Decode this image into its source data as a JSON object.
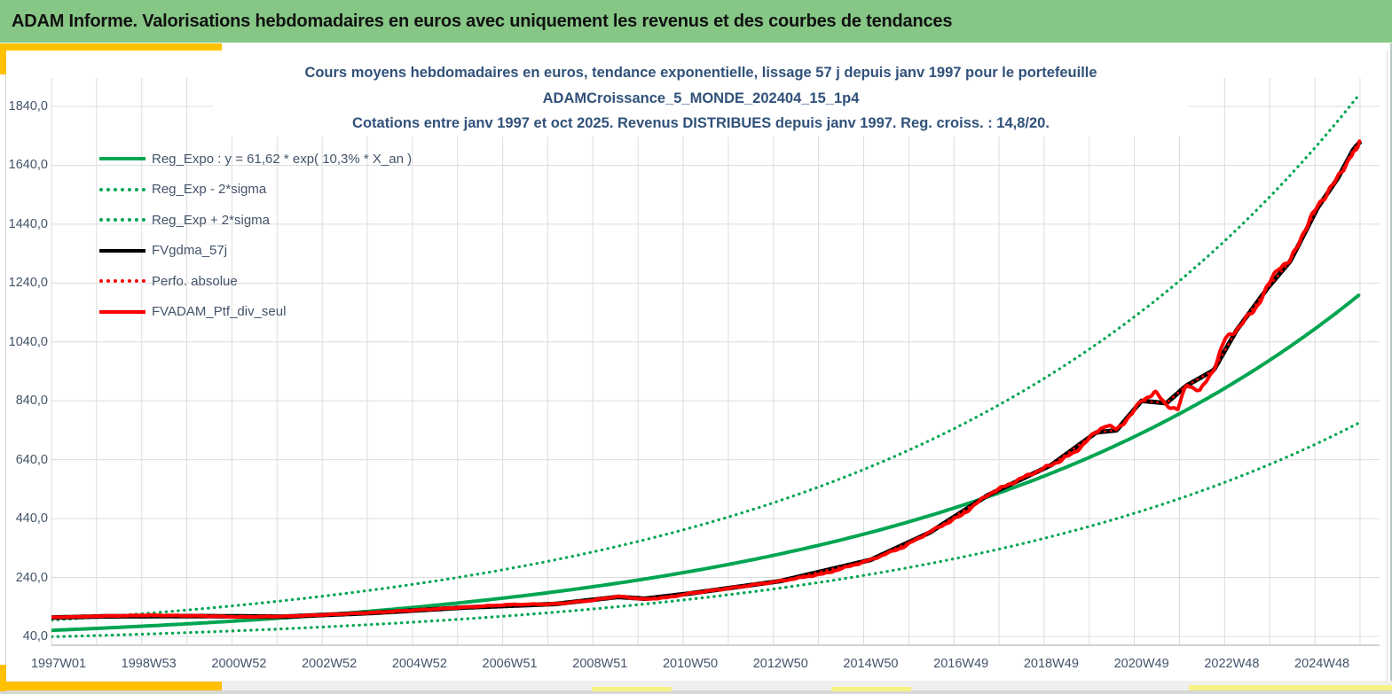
{
  "header": {
    "title": "ADAM Informe. Valorisations hebdomadaires en euros avec uniquement les revenus et des courbes de tendances",
    "bg_color": "#86c786"
  },
  "chart": {
    "title_line1": "Cours moyens hebdomadaires  en euros, tendance exponentielle, lissage 57 j depuis janv 1997 pour le portefeuille",
    "title_line2": "ADAMCroissance_5_MONDE_202404_15_1p4",
    "title_line3": "Cotations  entre janv 1997 et oct 2025. Revenus DISTRIBUES depuis janv 1997. Reg. croiss. : 14,8/20."
  },
  "legend": {
    "items": [
      {
        "label": "Reg_Expo : y = 61,62 * exp( 10,3% *  X_an )",
        "color": "#00a551",
        "style": "solid"
      },
      {
        "label": "Reg_Exp - 2*sigma",
        "color": "#00a551",
        "style": "dotted"
      },
      {
        "label": "Reg_Exp + 2*sigma",
        "color": "#00a551",
        "style": "dotted"
      },
      {
        "label": "FVgdma_57j",
        "color": "#000000",
        "style": "solid"
      },
      {
        "label": "Perfo. absolue",
        "color": "#ff0000",
        "style": "dotted"
      },
      {
        "label": "FVADAM_Ptf_div_seul",
        "color": "#ff0000",
        "style": "solid"
      }
    ]
  },
  "accents": {
    "gold": "#ffc000",
    "pale_yellow": "#f4f283"
  },
  "chart_data": {
    "type": "line",
    "x_axis": {
      "unit": "week (ISO year-week)",
      "tick_labels": [
        "1997W01",
        "1998W53",
        "2000W52",
        "2002W52",
        "2004W52",
        "2006W51",
        "2008W51",
        "2010W50",
        "2012W50",
        "2014W50",
        "2016W49",
        "2018W49",
        "2020W49",
        "2022W48",
        "2024W48"
      ],
      "years_span": [
        0,
        28.85
      ],
      "gridline_every_years": 1
    },
    "y_axis": {
      "tick_labels": [
        "40,0",
        "240,0",
        "440,0",
        "640,0",
        "840,0",
        "1040,0",
        "1240,0",
        "1440,0",
        "1640,0",
        "1840,0"
      ],
      "tick_values": [
        40,
        240,
        440,
        640,
        840,
        1040,
        1240,
        1440,
        1640,
        1840
      ],
      "ylim": [
        40,
        1840
      ],
      "grid": true,
      "grid_color": "#dcdcdc"
    },
    "regression": {
      "a": 61.62,
      "rate": 0.103,
      "sigma2_upper_factor": 1.567,
      "sigma2_lower_factor": 0.638,
      "equation": "y = 61,62 * exp( 10,3% * X_an )",
      "score": "14,8/20"
    },
    "series": [
      {
        "name": "Reg_Expo",
        "kind": "expo",
        "factor": 1.0,
        "color": "#00a551",
        "dash": "solid",
        "width": 4
      },
      {
        "name": "Reg_Exp - 2*sigma",
        "kind": "expo",
        "factor": 0.638,
        "color": "#00a551",
        "dash": "dotted",
        "width": 3.2
      },
      {
        "name": "Reg_Exp + 2*sigma",
        "kind": "expo",
        "factor": 1.567,
        "color": "#00a551",
        "dash": "dotted",
        "width": 3.2
      },
      {
        "name": "FVgdma_57j",
        "kind": "points",
        "color": "#000000",
        "dash": "solid",
        "width": 5.2,
        "wiggle": false,
        "points": [
          [
            -0.15,
            104
          ],
          [
            1,
            108
          ],
          [
            3,
            109
          ],
          [
            5,
            107
          ],
          [
            7,
            120
          ],
          [
            9,
            138
          ],
          [
            11,
            150
          ],
          [
            12.4,
            174
          ],
          [
            13,
            168
          ],
          [
            14,
            186
          ],
          [
            16,
            228
          ],
          [
            18,
            300
          ],
          [
            19.3,
            392
          ],
          [
            20.6,
            520
          ],
          [
            22,
            622
          ],
          [
            23,
            733
          ],
          [
            23.45,
            740
          ],
          [
            24,
            840
          ],
          [
            24.55,
            832
          ],
          [
            25,
            892
          ],
          [
            25.6,
            944
          ],
          [
            26.1,
            1078
          ],
          [
            26.8,
            1224
          ],
          [
            27.3,
            1315
          ],
          [
            27.9,
            1495
          ],
          [
            28.35,
            1596
          ],
          [
            28.7,
            1695
          ],
          [
            28.85,
            1720
          ]
        ]
      },
      {
        "name": "Perfo. absolue",
        "kind": "points",
        "color": "#ff0000",
        "dash": "dotted",
        "width": 2.6,
        "wiggle": false,
        "points": [
          [
            -0.15,
            104
          ],
          [
            1,
            108
          ],
          [
            3,
            109
          ],
          [
            5,
            107
          ],
          [
            7,
            120
          ],
          [
            9,
            138
          ],
          [
            11,
            150
          ],
          [
            12.4,
            174
          ],
          [
            13,
            168
          ],
          [
            14,
            186
          ],
          [
            16,
            228
          ],
          [
            18,
            300
          ],
          [
            19.3,
            392
          ],
          [
            20.6,
            520
          ],
          [
            22,
            622
          ],
          [
            23,
            733
          ],
          [
            23.45,
            740
          ],
          [
            24,
            840
          ],
          [
            24.55,
            832
          ],
          [
            25,
            892
          ],
          [
            25.6,
            944
          ],
          [
            26.1,
            1078
          ],
          [
            26.8,
            1224
          ],
          [
            27.3,
            1315
          ],
          [
            27.9,
            1495
          ],
          [
            28.35,
            1596
          ],
          [
            28.7,
            1695
          ],
          [
            28.85,
            1720
          ]
        ]
      },
      {
        "name": "FVADAM_Ptf_div_seul",
        "kind": "points",
        "color": "#ff0000",
        "dash": "solid",
        "width": 4,
        "wiggle": true,
        "points": [
          [
            -0.15,
            105
          ],
          [
            0,
            105
          ],
          [
            1,
            109
          ],
          [
            2,
            112
          ],
          [
            3,
            110
          ],
          [
            4,
            106
          ],
          [
            5,
            108
          ],
          [
            6,
            114
          ],
          [
            7,
            121
          ],
          [
            8,
            130
          ],
          [
            9,
            139
          ],
          [
            10,
            148
          ],
          [
            11,
            150
          ],
          [
            11.8,
            162
          ],
          [
            12.4,
            176
          ],
          [
            13,
            166
          ],
          [
            13.5,
            172
          ],
          [
            14,
            186
          ],
          [
            15,
            206
          ],
          [
            16,
            228
          ],
          [
            17,
            254
          ],
          [
            18,
            300
          ],
          [
            18.7,
            342
          ],
          [
            19.3,
            394
          ],
          [
            20,
            450
          ],
          [
            20.6,
            522
          ],
          [
            21,
            552
          ],
          [
            21.5,
            588
          ],
          [
            22,
            622
          ],
          [
            22.5,
            662
          ],
          [
            23,
            735
          ],
          [
            23.2,
            758
          ],
          [
            23.45,
            742
          ],
          [
            23.8,
            798
          ],
          [
            24,
            842
          ],
          [
            24.3,
            868
          ],
          [
            24.55,
            828
          ],
          [
            24.8,
            808
          ],
          [
            25,
            898
          ],
          [
            25.3,
            872
          ],
          [
            25.6,
            948
          ],
          [
            25.85,
            1048
          ],
          [
            26.1,
            1082
          ],
          [
            26.5,
            1148
          ],
          [
            26.8,
            1228
          ],
          [
            27.05,
            1298
          ],
          [
            27.3,
            1312
          ],
          [
            27.6,
            1418
          ],
          [
            27.9,
            1498
          ],
          [
            28.15,
            1558
          ],
          [
            28.35,
            1592
          ],
          [
            28.55,
            1652
          ],
          [
            28.7,
            1692
          ],
          [
            28.78,
            1678
          ],
          [
            28.85,
            1728
          ]
        ]
      }
    ]
  }
}
